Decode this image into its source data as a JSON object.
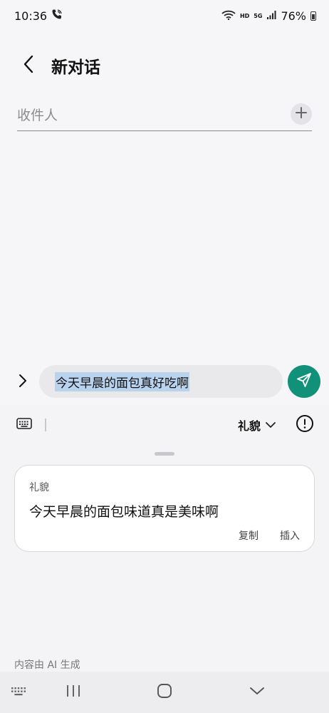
{
  "status_bar": {
    "time": "10:36",
    "network_small": "HD",
    "signal_small": "5G",
    "battery": "76%"
  },
  "header": {
    "title": "新对话",
    "back_icon": "chevron-left-icon"
  },
  "recipient": {
    "placeholder": "收件人",
    "value": "",
    "add_icon": "plus-icon"
  },
  "composer": {
    "message": "今天早晨的面包真好吃啊",
    "expand_icon": "chevron-right-icon",
    "send_icon": "send-icon",
    "send_color": "#12917a"
  },
  "ai_panel": {
    "tone_label": "礼貌",
    "tone_dropdown_icon": "chevron-down-icon",
    "info_icon": "info-icon",
    "keyboard_icon": "keyboard-icon",
    "suggestion": {
      "tag": "礼貌",
      "text": "今天早晨的面包味道真是美味啊",
      "copy_label": "复制",
      "insert_label": "插入"
    },
    "disclaimer": "内容由 AI 生成"
  },
  "nav_bar": {
    "keyboard_icon": "keyboard-icon",
    "recents_icon": "recents-icon",
    "home_icon": "home-icon",
    "back_icon": "chevron-down-icon"
  }
}
